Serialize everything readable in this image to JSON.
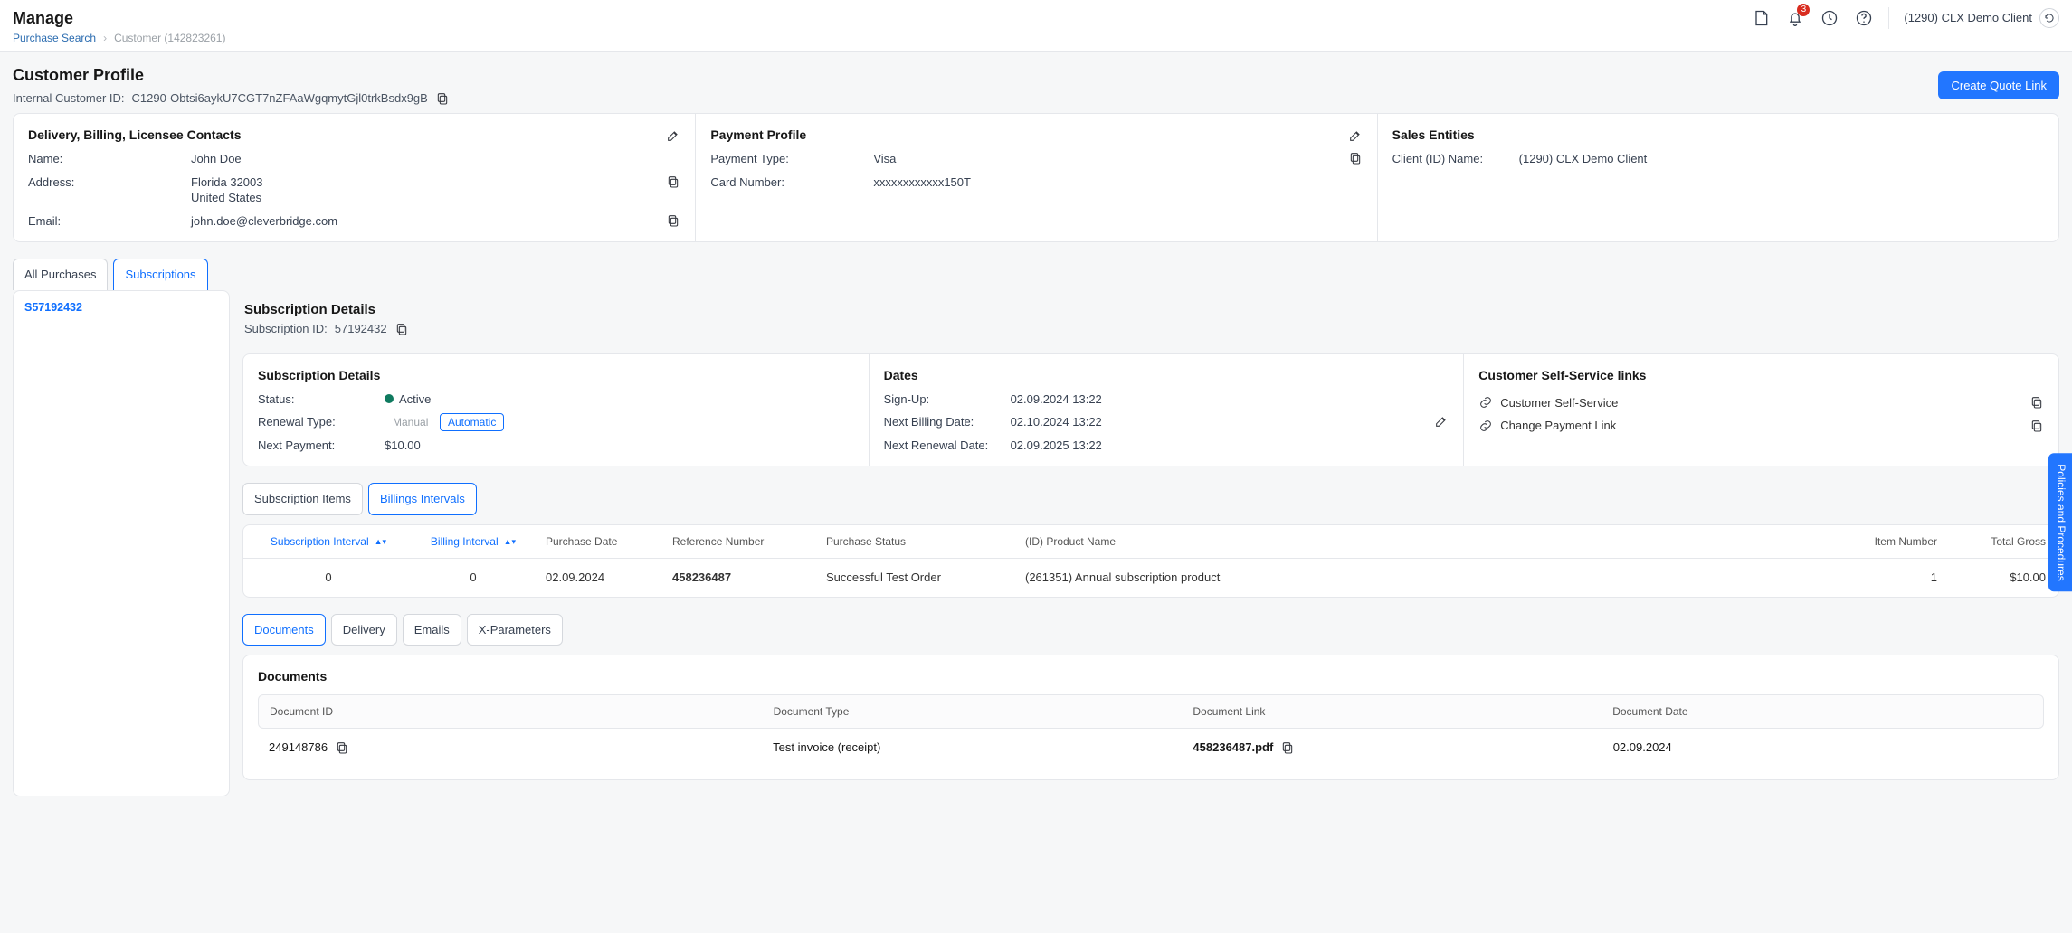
{
  "topbar": {
    "appTitle": "Manage",
    "breadcrumb": {
      "root": "Purchase Search",
      "current": "Customer (142823261)"
    },
    "notificationCount": "3",
    "clientLabel": "(1290) CLX Demo Client"
  },
  "pageHeader": {
    "title": "Customer Profile",
    "internalIdLabel": "Internal Customer ID:",
    "internalId": "C1290-Obtsi6aykU7CGT7nZFAaWgqmytGjl0trkBsdx9gB",
    "primaryCta": "Create Quote Link"
  },
  "contactsPanel": {
    "title": "Delivery, Billing, Licensee Contacts",
    "nameLabel": "Name:",
    "name": "John Doe",
    "addressLabel": "Address:",
    "addressLine1": "Florida 32003",
    "addressLine2": "United States",
    "emailLabel": "Email:",
    "email": "john.doe@cleverbridge.com"
  },
  "paymentPanel": {
    "title": "Payment Profile",
    "paymentTypeLabel": "Payment Type:",
    "paymentType": "Visa",
    "cardLabel": "Card Number:",
    "cardNumber": "xxxxxxxxxxxx150T"
  },
  "salesPanel": {
    "title": "Sales Entities",
    "clientIdNameLabel": "Client (ID) Name:",
    "clientIdName": "(1290) CLX Demo Client"
  },
  "tabs": {
    "allPurchases": "All Purchases",
    "subscriptions": "Subscriptions"
  },
  "sidebar": {
    "items": [
      {
        "label": "S57192432"
      }
    ]
  },
  "subscription": {
    "detailsTitle": "Subscription Details",
    "idLabel": "Subscription ID:",
    "id": "57192432",
    "detailsCard": {
      "title": "Subscription Details",
      "statusLabel": "Status:",
      "statusValue": "Active",
      "renewalTypeLabel": "Renewal Type:",
      "renewalManual": "Manual",
      "renewalAutomatic": "Automatic",
      "nextPaymentLabel": "Next Payment:",
      "nextPaymentValue": "$10.00"
    },
    "datesCard": {
      "title": "Dates",
      "signUpLabel": "Sign-Up:",
      "signUpValue": "02.09.2024 13:22",
      "nextBillingLabel": "Next Billing Date:",
      "nextBillingValue": "02.10.2024 13:22",
      "nextRenewalLabel": "Next Renewal Date:",
      "nextRenewalValue": "02.09.2025 13:22"
    },
    "selfServiceCard": {
      "title": "Customer Self-Service links",
      "link1": "Customer Self-Service",
      "link2": "Change Payment Link"
    }
  },
  "innerTabs": {
    "items": "Subscription Items",
    "intervals": "Billings Intervals"
  },
  "intervalsTable": {
    "headers": {
      "subInterval": "Subscription Interval",
      "billInterval": "Billing Interval",
      "purchaseDate": "Purchase Date",
      "reference": "Reference Number",
      "status": "Purchase Status",
      "product": "(ID) Product Name",
      "itemNumber": "Item Number",
      "totalGross": "Total Gross"
    },
    "row": {
      "subInterval": "0",
      "billInterval": "0",
      "purchaseDate": "02.09.2024",
      "reference": "458236487",
      "status": "Successful Test Order",
      "product": "(261351) Annual subscription product",
      "itemNumber": "1",
      "totalGross": "$10.00"
    }
  },
  "lowerTabs": {
    "documents": "Documents",
    "delivery": "Delivery",
    "emails": "Emails",
    "xparams": "X-Parameters"
  },
  "documentsCard": {
    "title": "Documents",
    "headers": {
      "id": "Document ID",
      "type": "Document Type",
      "link": "Document Link",
      "date": "Document Date"
    },
    "row": {
      "id": "249148786",
      "type": "Test invoice (receipt)",
      "linkName": "458236487.pdf",
      "date": "02.09.2024"
    }
  },
  "floating": {
    "label": "Policies and Procedures"
  }
}
